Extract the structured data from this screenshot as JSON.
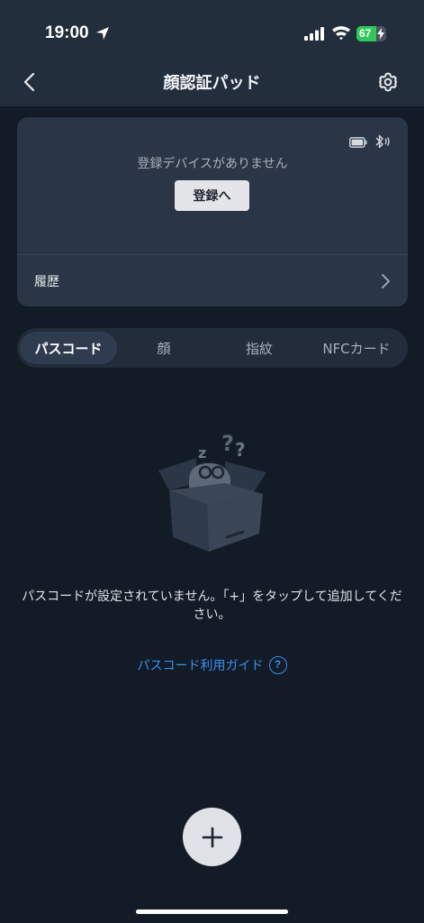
{
  "status_bar": {
    "time": "19:00",
    "battery_level": "67",
    "battery_percent": 67,
    "battery_color": "#31c75a"
  },
  "header": {
    "title": "顔認証パッド",
    "back_icon": "chevron-left-icon",
    "settings_icon": "gear-icon"
  },
  "device_card": {
    "no_device_text": "登録デバイスがありません",
    "register_label": "登録へ",
    "history_label": "履歴"
  },
  "tabs": [
    {
      "label": "パスコード",
      "active": true
    },
    {
      "label": "顔",
      "active": false
    },
    {
      "label": "指紋",
      "active": false
    },
    {
      "label": "NFCカード",
      "active": false
    }
  ],
  "empty_state": {
    "message": "パスコードが設定されていません。「+」をタップして追加してください。",
    "guide_label": "パスコード利用ガイド",
    "help_glyph": "?"
  },
  "fab": {
    "icon": "plus-icon"
  },
  "colors": {
    "background": "#131b26",
    "header": "#232e3d",
    "card": "#2a3546",
    "accent_link": "#3a8ff0"
  }
}
